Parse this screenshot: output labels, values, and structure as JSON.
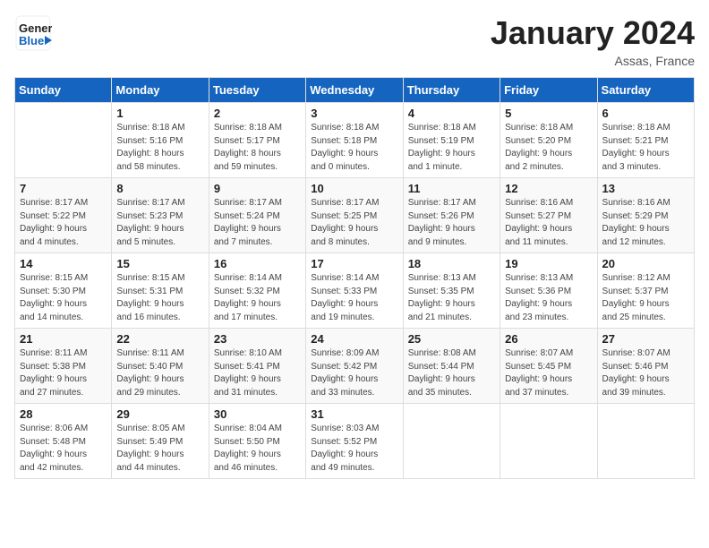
{
  "header": {
    "logo_line1": "General",
    "logo_line2": "Blue",
    "month_title": "January 2024",
    "location": "Assas, France"
  },
  "weekdays": [
    "Sunday",
    "Monday",
    "Tuesday",
    "Wednesday",
    "Thursday",
    "Friday",
    "Saturday"
  ],
  "weeks": [
    [
      {
        "day": "",
        "sunrise": "",
        "sunset": "",
        "daylight": ""
      },
      {
        "day": "1",
        "sunrise": "Sunrise: 8:18 AM",
        "sunset": "Sunset: 5:16 PM",
        "daylight": "Daylight: 8 hours",
        "daylight2": "and 58 minutes."
      },
      {
        "day": "2",
        "sunrise": "Sunrise: 8:18 AM",
        "sunset": "Sunset: 5:17 PM",
        "daylight": "Daylight: 8 hours",
        "daylight2": "and 59 minutes."
      },
      {
        "day": "3",
        "sunrise": "Sunrise: 8:18 AM",
        "sunset": "Sunset: 5:18 PM",
        "daylight": "Daylight: 9 hours",
        "daylight2": "and 0 minutes."
      },
      {
        "day": "4",
        "sunrise": "Sunrise: 8:18 AM",
        "sunset": "Sunset: 5:19 PM",
        "daylight": "Daylight: 9 hours",
        "daylight2": "and 1 minute."
      },
      {
        "day": "5",
        "sunrise": "Sunrise: 8:18 AM",
        "sunset": "Sunset: 5:20 PM",
        "daylight": "Daylight: 9 hours",
        "daylight2": "and 2 minutes."
      },
      {
        "day": "6",
        "sunrise": "Sunrise: 8:18 AM",
        "sunset": "Sunset: 5:21 PM",
        "daylight": "Daylight: 9 hours",
        "daylight2": "and 3 minutes."
      }
    ],
    [
      {
        "day": "7",
        "sunrise": "Sunrise: 8:17 AM",
        "sunset": "Sunset: 5:22 PM",
        "daylight": "Daylight: 9 hours",
        "daylight2": "and 4 minutes."
      },
      {
        "day": "8",
        "sunrise": "Sunrise: 8:17 AM",
        "sunset": "Sunset: 5:23 PM",
        "daylight": "Daylight: 9 hours",
        "daylight2": "and 5 minutes."
      },
      {
        "day": "9",
        "sunrise": "Sunrise: 8:17 AM",
        "sunset": "Sunset: 5:24 PM",
        "daylight": "Daylight: 9 hours",
        "daylight2": "and 7 minutes."
      },
      {
        "day": "10",
        "sunrise": "Sunrise: 8:17 AM",
        "sunset": "Sunset: 5:25 PM",
        "daylight": "Daylight: 9 hours",
        "daylight2": "and 8 minutes."
      },
      {
        "day": "11",
        "sunrise": "Sunrise: 8:17 AM",
        "sunset": "Sunset: 5:26 PM",
        "daylight": "Daylight: 9 hours",
        "daylight2": "and 9 minutes."
      },
      {
        "day": "12",
        "sunrise": "Sunrise: 8:16 AM",
        "sunset": "Sunset: 5:27 PM",
        "daylight": "Daylight: 9 hours",
        "daylight2": "and 11 minutes."
      },
      {
        "day": "13",
        "sunrise": "Sunrise: 8:16 AM",
        "sunset": "Sunset: 5:29 PM",
        "daylight": "Daylight: 9 hours",
        "daylight2": "and 12 minutes."
      }
    ],
    [
      {
        "day": "14",
        "sunrise": "Sunrise: 8:15 AM",
        "sunset": "Sunset: 5:30 PM",
        "daylight": "Daylight: 9 hours",
        "daylight2": "and 14 minutes."
      },
      {
        "day": "15",
        "sunrise": "Sunrise: 8:15 AM",
        "sunset": "Sunset: 5:31 PM",
        "daylight": "Daylight: 9 hours",
        "daylight2": "and 16 minutes."
      },
      {
        "day": "16",
        "sunrise": "Sunrise: 8:14 AM",
        "sunset": "Sunset: 5:32 PM",
        "daylight": "Daylight: 9 hours",
        "daylight2": "and 17 minutes."
      },
      {
        "day": "17",
        "sunrise": "Sunrise: 8:14 AM",
        "sunset": "Sunset: 5:33 PM",
        "daylight": "Daylight: 9 hours",
        "daylight2": "and 19 minutes."
      },
      {
        "day": "18",
        "sunrise": "Sunrise: 8:13 AM",
        "sunset": "Sunset: 5:35 PM",
        "daylight": "Daylight: 9 hours",
        "daylight2": "and 21 minutes."
      },
      {
        "day": "19",
        "sunrise": "Sunrise: 8:13 AM",
        "sunset": "Sunset: 5:36 PM",
        "daylight": "Daylight: 9 hours",
        "daylight2": "and 23 minutes."
      },
      {
        "day": "20",
        "sunrise": "Sunrise: 8:12 AM",
        "sunset": "Sunset: 5:37 PM",
        "daylight": "Daylight: 9 hours",
        "daylight2": "and 25 minutes."
      }
    ],
    [
      {
        "day": "21",
        "sunrise": "Sunrise: 8:11 AM",
        "sunset": "Sunset: 5:38 PM",
        "daylight": "Daylight: 9 hours",
        "daylight2": "and 27 minutes."
      },
      {
        "day": "22",
        "sunrise": "Sunrise: 8:11 AM",
        "sunset": "Sunset: 5:40 PM",
        "daylight": "Daylight: 9 hours",
        "daylight2": "and 29 minutes."
      },
      {
        "day": "23",
        "sunrise": "Sunrise: 8:10 AM",
        "sunset": "Sunset: 5:41 PM",
        "daylight": "Daylight: 9 hours",
        "daylight2": "and 31 minutes."
      },
      {
        "day": "24",
        "sunrise": "Sunrise: 8:09 AM",
        "sunset": "Sunset: 5:42 PM",
        "daylight": "Daylight: 9 hours",
        "daylight2": "and 33 minutes."
      },
      {
        "day": "25",
        "sunrise": "Sunrise: 8:08 AM",
        "sunset": "Sunset: 5:44 PM",
        "daylight": "Daylight: 9 hours",
        "daylight2": "and 35 minutes."
      },
      {
        "day": "26",
        "sunrise": "Sunrise: 8:07 AM",
        "sunset": "Sunset: 5:45 PM",
        "daylight": "Daylight: 9 hours",
        "daylight2": "and 37 minutes."
      },
      {
        "day": "27",
        "sunrise": "Sunrise: 8:07 AM",
        "sunset": "Sunset: 5:46 PM",
        "daylight": "Daylight: 9 hours",
        "daylight2": "and 39 minutes."
      }
    ],
    [
      {
        "day": "28",
        "sunrise": "Sunrise: 8:06 AM",
        "sunset": "Sunset: 5:48 PM",
        "daylight": "Daylight: 9 hours",
        "daylight2": "and 42 minutes."
      },
      {
        "day": "29",
        "sunrise": "Sunrise: 8:05 AM",
        "sunset": "Sunset: 5:49 PM",
        "daylight": "Daylight: 9 hours",
        "daylight2": "and 44 minutes."
      },
      {
        "day": "30",
        "sunrise": "Sunrise: 8:04 AM",
        "sunset": "Sunset: 5:50 PM",
        "daylight": "Daylight: 9 hours",
        "daylight2": "and 46 minutes."
      },
      {
        "day": "31",
        "sunrise": "Sunrise: 8:03 AM",
        "sunset": "Sunset: 5:52 PM",
        "daylight": "Daylight: 9 hours",
        "daylight2": "and 49 minutes."
      },
      {
        "day": "",
        "sunrise": "",
        "sunset": "",
        "daylight": "",
        "daylight2": ""
      },
      {
        "day": "",
        "sunrise": "",
        "sunset": "",
        "daylight": "",
        "daylight2": ""
      },
      {
        "day": "",
        "sunrise": "",
        "sunset": "",
        "daylight": "",
        "daylight2": ""
      }
    ]
  ]
}
